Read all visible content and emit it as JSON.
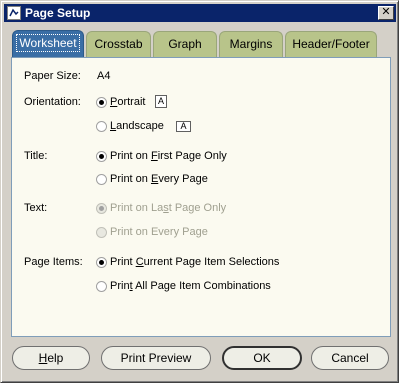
{
  "window": {
    "title": "Page Setup",
    "close_glyph": "✕"
  },
  "tabs": [
    {
      "label": "Worksheet",
      "active": true
    },
    {
      "label": "Crosstab"
    },
    {
      "label": "Graph"
    },
    {
      "label": "Margins"
    },
    {
      "label": "Header/Footer"
    }
  ],
  "paper": {
    "label": "Paper Size:",
    "value": "A4"
  },
  "orientation": {
    "label": "Orientation:",
    "portrait": {
      "pre": "",
      "mn": "P",
      "post": "ortrait"
    },
    "landscape": {
      "pre": "",
      "mn": "L",
      "post": "andscape"
    },
    "icon_glyph": "A"
  },
  "title_section": {
    "label": "Title:",
    "first": {
      "pre": "Print on ",
      "mn": "F",
      "post": "irst Page Only"
    },
    "every": {
      "pre": "Print on ",
      "mn": "E",
      "post": "very Page"
    }
  },
  "text_section": {
    "label": "Text:",
    "last": {
      "pre": "Print on La",
      "mn": "s",
      "post": "t Page Only"
    },
    "every": {
      "pre": "Print on Every Page"
    }
  },
  "page_items": {
    "label": "Page Items:",
    "current": {
      "pre": "Print ",
      "mn": "C",
      "post": "urrent Page Item Selections"
    },
    "all": {
      "pre": "Prin",
      "mn": "t",
      "post": " All Page Item Combinations"
    }
  },
  "buttons": {
    "help": {
      "pre": "",
      "mn": "H",
      "post": "elp"
    },
    "print_preview": "Print Preview",
    "ok": "OK",
    "cancel": "Cancel"
  }
}
